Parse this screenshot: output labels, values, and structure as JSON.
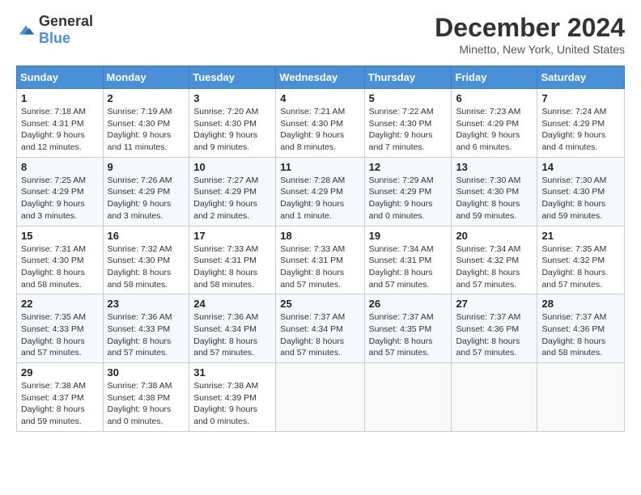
{
  "logo": {
    "text_general": "General",
    "text_blue": "Blue"
  },
  "title": "December 2024",
  "subtitle": "Minetto, New York, United States",
  "days_of_week": [
    "Sunday",
    "Monday",
    "Tuesday",
    "Wednesday",
    "Thursday",
    "Friday",
    "Saturday"
  ],
  "weeks": [
    [
      {
        "day": "1",
        "sunrise": "Sunrise: 7:18 AM",
        "sunset": "Sunset: 4:31 PM",
        "daylight": "Daylight: 9 hours and 12 minutes."
      },
      {
        "day": "2",
        "sunrise": "Sunrise: 7:19 AM",
        "sunset": "Sunset: 4:30 PM",
        "daylight": "Daylight: 9 hours and 11 minutes."
      },
      {
        "day": "3",
        "sunrise": "Sunrise: 7:20 AM",
        "sunset": "Sunset: 4:30 PM",
        "daylight": "Daylight: 9 hours and 9 minutes."
      },
      {
        "day": "4",
        "sunrise": "Sunrise: 7:21 AM",
        "sunset": "Sunset: 4:30 PM",
        "daylight": "Daylight: 9 hours and 8 minutes."
      },
      {
        "day": "5",
        "sunrise": "Sunrise: 7:22 AM",
        "sunset": "Sunset: 4:30 PM",
        "daylight": "Daylight: 9 hours and 7 minutes."
      },
      {
        "day": "6",
        "sunrise": "Sunrise: 7:23 AM",
        "sunset": "Sunset: 4:29 PM",
        "daylight": "Daylight: 9 hours and 6 minutes."
      },
      {
        "day": "7",
        "sunrise": "Sunrise: 7:24 AM",
        "sunset": "Sunset: 4:29 PM",
        "daylight": "Daylight: 9 hours and 4 minutes."
      }
    ],
    [
      {
        "day": "8",
        "sunrise": "Sunrise: 7:25 AM",
        "sunset": "Sunset: 4:29 PM",
        "daylight": "Daylight: 9 hours and 3 minutes."
      },
      {
        "day": "9",
        "sunrise": "Sunrise: 7:26 AM",
        "sunset": "Sunset: 4:29 PM",
        "daylight": "Daylight: 9 hours and 3 minutes."
      },
      {
        "day": "10",
        "sunrise": "Sunrise: 7:27 AM",
        "sunset": "Sunset: 4:29 PM",
        "daylight": "Daylight: 9 hours and 2 minutes."
      },
      {
        "day": "11",
        "sunrise": "Sunrise: 7:28 AM",
        "sunset": "Sunset: 4:29 PM",
        "daylight": "Daylight: 9 hours and 1 minute."
      },
      {
        "day": "12",
        "sunrise": "Sunrise: 7:29 AM",
        "sunset": "Sunset: 4:29 PM",
        "daylight": "Daylight: 9 hours and 0 minutes."
      },
      {
        "day": "13",
        "sunrise": "Sunrise: 7:30 AM",
        "sunset": "Sunset: 4:30 PM",
        "daylight": "Daylight: 8 hours and 59 minutes."
      },
      {
        "day": "14",
        "sunrise": "Sunrise: 7:30 AM",
        "sunset": "Sunset: 4:30 PM",
        "daylight": "Daylight: 8 hours and 59 minutes."
      }
    ],
    [
      {
        "day": "15",
        "sunrise": "Sunrise: 7:31 AM",
        "sunset": "Sunset: 4:30 PM",
        "daylight": "Daylight: 8 hours and 58 minutes."
      },
      {
        "day": "16",
        "sunrise": "Sunrise: 7:32 AM",
        "sunset": "Sunset: 4:30 PM",
        "daylight": "Daylight: 8 hours and 58 minutes."
      },
      {
        "day": "17",
        "sunrise": "Sunrise: 7:33 AM",
        "sunset": "Sunset: 4:31 PM",
        "daylight": "Daylight: 8 hours and 58 minutes."
      },
      {
        "day": "18",
        "sunrise": "Sunrise: 7:33 AM",
        "sunset": "Sunset: 4:31 PM",
        "daylight": "Daylight: 8 hours and 57 minutes."
      },
      {
        "day": "19",
        "sunrise": "Sunrise: 7:34 AM",
        "sunset": "Sunset: 4:31 PM",
        "daylight": "Daylight: 8 hours and 57 minutes."
      },
      {
        "day": "20",
        "sunrise": "Sunrise: 7:34 AM",
        "sunset": "Sunset: 4:32 PM",
        "daylight": "Daylight: 8 hours and 57 minutes."
      },
      {
        "day": "21",
        "sunrise": "Sunrise: 7:35 AM",
        "sunset": "Sunset: 4:32 PM",
        "daylight": "Daylight: 8 hours and 57 minutes."
      }
    ],
    [
      {
        "day": "22",
        "sunrise": "Sunrise: 7:35 AM",
        "sunset": "Sunset: 4:33 PM",
        "daylight": "Daylight: 8 hours and 57 minutes."
      },
      {
        "day": "23",
        "sunrise": "Sunrise: 7:36 AM",
        "sunset": "Sunset: 4:33 PM",
        "daylight": "Daylight: 8 hours and 57 minutes."
      },
      {
        "day": "24",
        "sunrise": "Sunrise: 7:36 AM",
        "sunset": "Sunset: 4:34 PM",
        "daylight": "Daylight: 8 hours and 57 minutes."
      },
      {
        "day": "25",
        "sunrise": "Sunrise: 7:37 AM",
        "sunset": "Sunset: 4:34 PM",
        "daylight": "Daylight: 8 hours and 57 minutes."
      },
      {
        "day": "26",
        "sunrise": "Sunrise: 7:37 AM",
        "sunset": "Sunset: 4:35 PM",
        "daylight": "Daylight: 8 hours and 57 minutes."
      },
      {
        "day": "27",
        "sunrise": "Sunrise: 7:37 AM",
        "sunset": "Sunset: 4:36 PM",
        "daylight": "Daylight: 8 hours and 57 minutes."
      },
      {
        "day": "28",
        "sunrise": "Sunrise: 7:37 AM",
        "sunset": "Sunset: 4:36 PM",
        "daylight": "Daylight: 8 hours and 58 minutes."
      }
    ],
    [
      {
        "day": "29",
        "sunrise": "Sunrise: 7:38 AM",
        "sunset": "Sunset: 4:37 PM",
        "daylight": "Daylight: 8 hours and 59 minutes."
      },
      {
        "day": "30",
        "sunrise": "Sunrise: 7:38 AM",
        "sunset": "Sunset: 4:38 PM",
        "daylight": "Daylight: 9 hours and 0 minutes."
      },
      {
        "day": "31",
        "sunrise": "Sunrise: 7:38 AM",
        "sunset": "Sunset: 4:39 PM",
        "daylight": "Daylight: 9 hours and 0 minutes."
      },
      null,
      null,
      null,
      null
    ]
  ]
}
